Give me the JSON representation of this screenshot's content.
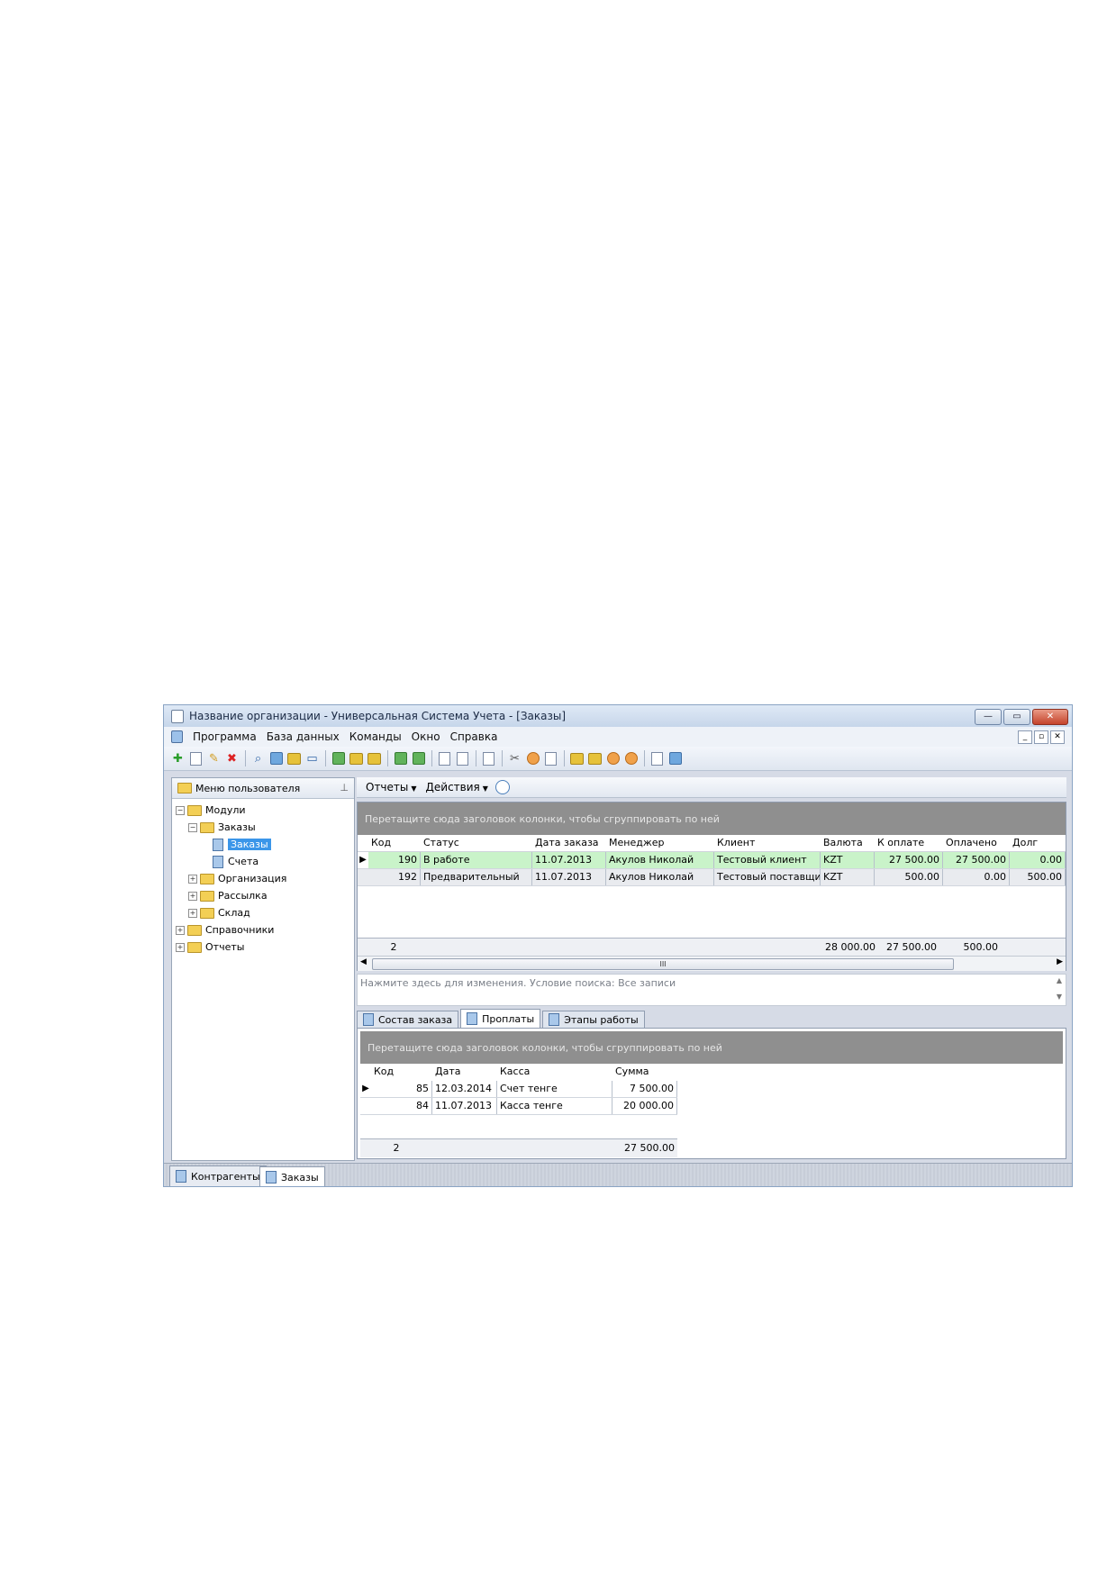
{
  "window": {
    "title": "Название организации - Универсальная Система Учета - [Заказы]"
  },
  "menu": [
    "Программа",
    "База данных",
    "Команды",
    "Окно",
    "Справка"
  ],
  "toolbar_icons": [
    "add-icon",
    "copy-icon",
    "edit-icon",
    "delete-icon",
    "search-icon",
    "find-icon",
    "filter-icon",
    "comment-icon",
    "report-icon",
    "import-icon",
    "export-icon",
    "excel-icon",
    "excel-export-icon",
    "new-window-icon",
    "close-window-icon",
    "print-icon",
    "tools-icon",
    "settings-icon",
    "notes-icon",
    "lock-icon",
    "key-icon",
    "palette-icon",
    "user-icon",
    "help-book-icon",
    "info-icon"
  ],
  "left_panel": {
    "title": "Меню пользователя",
    "tree": [
      {
        "label": "Модули",
        "level": 0,
        "expander": "−",
        "icon": "folder"
      },
      {
        "label": "Заказы",
        "level": 1,
        "expander": "−",
        "icon": "folder"
      },
      {
        "label": "Заказы",
        "level": 2,
        "expander": "",
        "icon": "doc",
        "selected": true
      },
      {
        "label": "Счета",
        "level": 2,
        "expander": "",
        "icon": "doc"
      },
      {
        "label": "Организация",
        "level": 1,
        "expander": "+",
        "icon": "folder"
      },
      {
        "label": "Рассылка",
        "level": 1,
        "expander": "+",
        "icon": "folder"
      },
      {
        "label": "Склад",
        "level": 1,
        "expander": "+",
        "icon": "folder"
      },
      {
        "label": "Справочники",
        "level": 0,
        "expander": "+",
        "icon": "folder"
      },
      {
        "label": "Отчеты",
        "level": 0,
        "expander": "+",
        "icon": "folder"
      }
    ]
  },
  "right_toolbar": {
    "reports": "Отчеты",
    "actions": "Действия"
  },
  "main_grid": {
    "group_hint": "Перетащите сюда заголовок колонки, чтобы сгруппировать по ней",
    "columns": [
      "Код",
      "Статус",
      "Дата заказа",
      "Менеджер",
      "Клиент",
      "Валюта",
      "К оплате",
      "Оплачено",
      "Долг"
    ],
    "rows": [
      [
        "190",
        "В работе",
        "11.07.2013",
        "Акулов Николай",
        "Тестовый клиент",
        "KZT",
        "27 500.00",
        "27 500.00",
        "0.00"
      ],
      [
        "192",
        "Предварительный",
        "11.07.2013",
        "Акулов Николай",
        "Тестовый поставщик",
        "KZT",
        "500.00",
        "0.00",
        "500.00"
      ]
    ],
    "footer": {
      "count": "2",
      "to_pay": "28 000.00",
      "paid": "27 500.00",
      "debt": "500.00"
    },
    "row_colors": [
      "#c9f3c9",
      "#e9ebef"
    ]
  },
  "filter_text": "Нажмите здесь для изменения. Условие поиска: Все записи",
  "detail_tabs": [
    "Состав заказа",
    "Проплаты",
    "Этапы работы"
  ],
  "detail_grid": {
    "group_hint": "Перетащите сюда заголовок колонки, чтобы сгруппировать по ней",
    "columns": [
      "Код",
      "Дата",
      "Касса",
      "Сумма"
    ],
    "rows": [
      [
        "85",
        "12.03.2014",
        "Счет тенге",
        "7 500.00"
      ],
      [
        "84",
        "11.07.2013",
        "Касса тенге",
        "20 000.00"
      ]
    ],
    "footer": {
      "count": "2",
      "sum": "27 500.00"
    }
  },
  "bottom_tabs": [
    "Контрагенты",
    "Заказы"
  ]
}
